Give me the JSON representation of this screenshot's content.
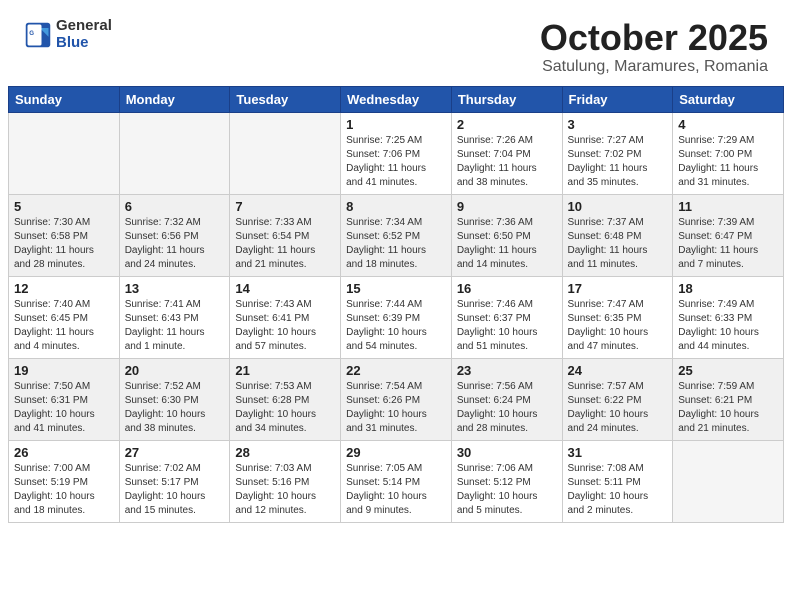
{
  "header": {
    "logo": {
      "general": "General",
      "blue": "Blue"
    },
    "title": "October 2025",
    "location": "Satulung, Maramures, Romania"
  },
  "weekdays": [
    "Sunday",
    "Monday",
    "Tuesday",
    "Wednesday",
    "Thursday",
    "Friday",
    "Saturday"
  ],
  "weeks": [
    [
      {
        "day": "",
        "info": ""
      },
      {
        "day": "",
        "info": ""
      },
      {
        "day": "",
        "info": ""
      },
      {
        "day": "1",
        "info": "Sunrise: 7:25 AM\nSunset: 7:06 PM\nDaylight: 11 hours\nand 41 minutes."
      },
      {
        "day": "2",
        "info": "Sunrise: 7:26 AM\nSunset: 7:04 PM\nDaylight: 11 hours\nand 38 minutes."
      },
      {
        "day": "3",
        "info": "Sunrise: 7:27 AM\nSunset: 7:02 PM\nDaylight: 11 hours\nand 35 minutes."
      },
      {
        "day": "4",
        "info": "Sunrise: 7:29 AM\nSunset: 7:00 PM\nDaylight: 11 hours\nand 31 minutes."
      }
    ],
    [
      {
        "day": "5",
        "info": "Sunrise: 7:30 AM\nSunset: 6:58 PM\nDaylight: 11 hours\nand 28 minutes."
      },
      {
        "day": "6",
        "info": "Sunrise: 7:32 AM\nSunset: 6:56 PM\nDaylight: 11 hours\nand 24 minutes."
      },
      {
        "day": "7",
        "info": "Sunrise: 7:33 AM\nSunset: 6:54 PM\nDaylight: 11 hours\nand 21 minutes."
      },
      {
        "day": "8",
        "info": "Sunrise: 7:34 AM\nSunset: 6:52 PM\nDaylight: 11 hours\nand 18 minutes."
      },
      {
        "day": "9",
        "info": "Sunrise: 7:36 AM\nSunset: 6:50 PM\nDaylight: 11 hours\nand 14 minutes."
      },
      {
        "day": "10",
        "info": "Sunrise: 7:37 AM\nSunset: 6:48 PM\nDaylight: 11 hours\nand 11 minutes."
      },
      {
        "day": "11",
        "info": "Sunrise: 7:39 AM\nSunset: 6:47 PM\nDaylight: 11 hours\nand 7 minutes."
      }
    ],
    [
      {
        "day": "12",
        "info": "Sunrise: 7:40 AM\nSunset: 6:45 PM\nDaylight: 11 hours\nand 4 minutes."
      },
      {
        "day": "13",
        "info": "Sunrise: 7:41 AM\nSunset: 6:43 PM\nDaylight: 11 hours\nand 1 minute."
      },
      {
        "day": "14",
        "info": "Sunrise: 7:43 AM\nSunset: 6:41 PM\nDaylight: 10 hours\nand 57 minutes."
      },
      {
        "day": "15",
        "info": "Sunrise: 7:44 AM\nSunset: 6:39 PM\nDaylight: 10 hours\nand 54 minutes."
      },
      {
        "day": "16",
        "info": "Sunrise: 7:46 AM\nSunset: 6:37 PM\nDaylight: 10 hours\nand 51 minutes."
      },
      {
        "day": "17",
        "info": "Sunrise: 7:47 AM\nSunset: 6:35 PM\nDaylight: 10 hours\nand 47 minutes."
      },
      {
        "day": "18",
        "info": "Sunrise: 7:49 AM\nSunset: 6:33 PM\nDaylight: 10 hours\nand 44 minutes."
      }
    ],
    [
      {
        "day": "19",
        "info": "Sunrise: 7:50 AM\nSunset: 6:31 PM\nDaylight: 10 hours\nand 41 minutes."
      },
      {
        "day": "20",
        "info": "Sunrise: 7:52 AM\nSunset: 6:30 PM\nDaylight: 10 hours\nand 38 minutes."
      },
      {
        "day": "21",
        "info": "Sunrise: 7:53 AM\nSunset: 6:28 PM\nDaylight: 10 hours\nand 34 minutes."
      },
      {
        "day": "22",
        "info": "Sunrise: 7:54 AM\nSunset: 6:26 PM\nDaylight: 10 hours\nand 31 minutes."
      },
      {
        "day": "23",
        "info": "Sunrise: 7:56 AM\nSunset: 6:24 PM\nDaylight: 10 hours\nand 28 minutes."
      },
      {
        "day": "24",
        "info": "Sunrise: 7:57 AM\nSunset: 6:22 PM\nDaylight: 10 hours\nand 24 minutes."
      },
      {
        "day": "25",
        "info": "Sunrise: 7:59 AM\nSunset: 6:21 PM\nDaylight: 10 hours\nand 21 minutes."
      }
    ],
    [
      {
        "day": "26",
        "info": "Sunrise: 7:00 AM\nSunset: 5:19 PM\nDaylight: 10 hours\nand 18 minutes."
      },
      {
        "day": "27",
        "info": "Sunrise: 7:02 AM\nSunset: 5:17 PM\nDaylight: 10 hours\nand 15 minutes."
      },
      {
        "day": "28",
        "info": "Sunrise: 7:03 AM\nSunset: 5:16 PM\nDaylight: 10 hours\nand 12 minutes."
      },
      {
        "day": "29",
        "info": "Sunrise: 7:05 AM\nSunset: 5:14 PM\nDaylight: 10 hours\nand 9 minutes."
      },
      {
        "day": "30",
        "info": "Sunrise: 7:06 AM\nSunset: 5:12 PM\nDaylight: 10 hours\nand 5 minutes."
      },
      {
        "day": "31",
        "info": "Sunrise: 7:08 AM\nSunset: 5:11 PM\nDaylight: 10 hours\nand 2 minutes."
      },
      {
        "day": "",
        "info": ""
      }
    ]
  ]
}
